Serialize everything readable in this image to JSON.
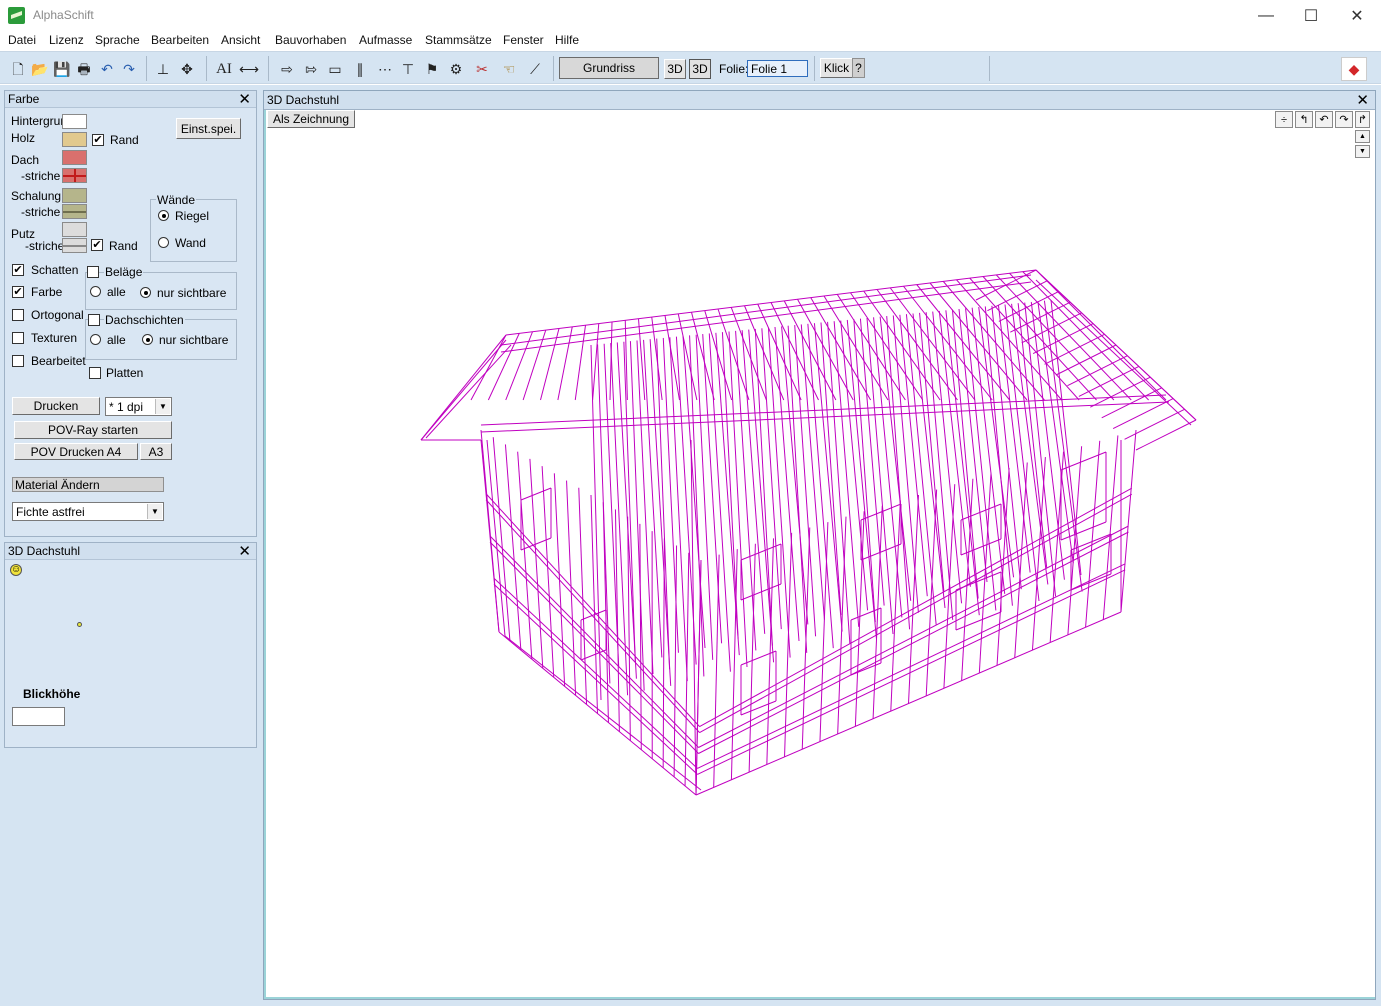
{
  "window": {
    "title": "AlphaSchift",
    "minimize": "—",
    "maximize": "☐",
    "close": "✕"
  },
  "menu": [
    "Datei",
    "Lizenz",
    "Sprache",
    "Bearbeiten",
    "Ansicht",
    "Bauvorhaben",
    "Aufmasse",
    "Stammsätze",
    "Fenster",
    "Hilfe"
  ],
  "toolbar": {
    "icons": {
      "new": "🗋",
      "open": "📂",
      "save": "💾",
      "print": "🖶",
      "undo": "↶",
      "redo": "↷",
      "dimension": "⊥",
      "move": "✥",
      "text": "AI",
      "measure": "⟷",
      "arrow-right": "⇨",
      "arrow-right-outline": "⇰",
      "rect": "▭",
      "parallel": "∥",
      "dotline": "⋯",
      "split": "⊤",
      "tool-a": "⚑",
      "gear": "⚙",
      "tools": "✂",
      "hand": "☜",
      "polyline": "⟋",
      "warning": "◆"
    },
    "grundriss": "Grundriss",
    "view3d_a": "3D",
    "view3d_b": "3D",
    "folie_label": "Folie:",
    "folie_value": "Folie 1",
    "klick": "Klick",
    "help": "?"
  },
  "panel_farbe": {
    "title": "Farbe",
    "close": "✕",
    "hintergrund": "Hintergrund",
    "holz": "Holz",
    "rand": "Rand",
    "dach": "Dach",
    "striche": "-striche",
    "schalung": "Schalung",
    "putz": "Putz",
    "einst_spei": "Einst.spei.",
    "waende": "Wände",
    "riegel": "Riegel",
    "wand": "Wand",
    "schatten": "Schatten",
    "farbe": "Farbe",
    "ortogonal": "Ortogonal",
    "texturen": "Texturen",
    "bearbeitet": "Bearbeitet",
    "belaege": "Beläge",
    "alle": "alle",
    "nur_sichtbare": "nur sichtbare",
    "dachschichten": "Dachschichten",
    "platten": "Platten",
    "drucken": "Drucken",
    "dpi": "* 1 dpi",
    "povray": "POV-Ray starten",
    "pov_a4": "POV Drucken A4",
    "a3": "A3",
    "material_aendern": "Material Ändern",
    "material": "Fichte astfrei",
    "check": "✔",
    "arrow": "▼",
    "colors": {
      "holz": "#e1c98e",
      "dach": "#d9706d",
      "schalung": "#b5b58b",
      "putz": "#dcdcdc",
      "striche_red": "#c21a1a"
    }
  },
  "panel_3d": {
    "title": "3D Dachstuhl",
    "close": "✕",
    "blickhoehe": "Blickhöhe",
    "smiley": "☺"
  },
  "doc": {
    "title": "3D Dachstuhl",
    "close": "✕",
    "als_zeichnung": "Als Zeichnung",
    "nav": [
      "÷",
      "↰",
      "↶",
      "↷",
      "↱"
    ],
    "scroll_up": "▲",
    "scroll_down": "▼",
    "wire_color": "#c000c0"
  }
}
